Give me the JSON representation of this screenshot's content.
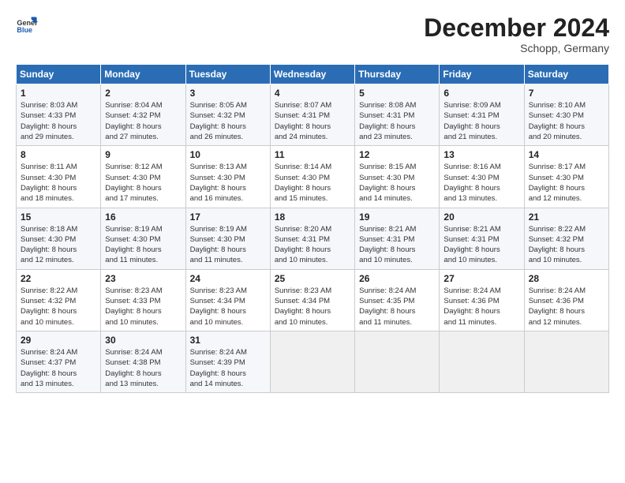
{
  "header": {
    "logo_general": "General",
    "logo_blue": "Blue",
    "month_title": "December 2024",
    "location": "Schopp, Germany"
  },
  "days_of_week": [
    "Sunday",
    "Monday",
    "Tuesday",
    "Wednesday",
    "Thursday",
    "Friday",
    "Saturday"
  ],
  "weeks": [
    [
      {
        "day": "1",
        "info": "Sunrise: 8:03 AM\nSunset: 4:33 PM\nDaylight: 8 hours\nand 29 minutes."
      },
      {
        "day": "2",
        "info": "Sunrise: 8:04 AM\nSunset: 4:32 PM\nDaylight: 8 hours\nand 27 minutes."
      },
      {
        "day": "3",
        "info": "Sunrise: 8:05 AM\nSunset: 4:32 PM\nDaylight: 8 hours\nand 26 minutes."
      },
      {
        "day": "4",
        "info": "Sunrise: 8:07 AM\nSunset: 4:31 PM\nDaylight: 8 hours\nand 24 minutes."
      },
      {
        "day": "5",
        "info": "Sunrise: 8:08 AM\nSunset: 4:31 PM\nDaylight: 8 hours\nand 23 minutes."
      },
      {
        "day": "6",
        "info": "Sunrise: 8:09 AM\nSunset: 4:31 PM\nDaylight: 8 hours\nand 21 minutes."
      },
      {
        "day": "7",
        "info": "Sunrise: 8:10 AM\nSunset: 4:30 PM\nDaylight: 8 hours\nand 20 minutes."
      }
    ],
    [
      {
        "day": "8",
        "info": "Sunrise: 8:11 AM\nSunset: 4:30 PM\nDaylight: 8 hours\nand 18 minutes."
      },
      {
        "day": "9",
        "info": "Sunrise: 8:12 AM\nSunset: 4:30 PM\nDaylight: 8 hours\nand 17 minutes."
      },
      {
        "day": "10",
        "info": "Sunrise: 8:13 AM\nSunset: 4:30 PM\nDaylight: 8 hours\nand 16 minutes."
      },
      {
        "day": "11",
        "info": "Sunrise: 8:14 AM\nSunset: 4:30 PM\nDaylight: 8 hours\nand 15 minutes."
      },
      {
        "day": "12",
        "info": "Sunrise: 8:15 AM\nSunset: 4:30 PM\nDaylight: 8 hours\nand 14 minutes."
      },
      {
        "day": "13",
        "info": "Sunrise: 8:16 AM\nSunset: 4:30 PM\nDaylight: 8 hours\nand 13 minutes."
      },
      {
        "day": "14",
        "info": "Sunrise: 8:17 AM\nSunset: 4:30 PM\nDaylight: 8 hours\nand 12 minutes."
      }
    ],
    [
      {
        "day": "15",
        "info": "Sunrise: 8:18 AM\nSunset: 4:30 PM\nDaylight: 8 hours\nand 12 minutes."
      },
      {
        "day": "16",
        "info": "Sunrise: 8:19 AM\nSunset: 4:30 PM\nDaylight: 8 hours\nand 11 minutes."
      },
      {
        "day": "17",
        "info": "Sunrise: 8:19 AM\nSunset: 4:30 PM\nDaylight: 8 hours\nand 11 minutes."
      },
      {
        "day": "18",
        "info": "Sunrise: 8:20 AM\nSunset: 4:31 PM\nDaylight: 8 hours\nand 10 minutes."
      },
      {
        "day": "19",
        "info": "Sunrise: 8:21 AM\nSunset: 4:31 PM\nDaylight: 8 hours\nand 10 minutes."
      },
      {
        "day": "20",
        "info": "Sunrise: 8:21 AM\nSunset: 4:31 PM\nDaylight: 8 hours\nand 10 minutes."
      },
      {
        "day": "21",
        "info": "Sunrise: 8:22 AM\nSunset: 4:32 PM\nDaylight: 8 hours\nand 10 minutes."
      }
    ],
    [
      {
        "day": "22",
        "info": "Sunrise: 8:22 AM\nSunset: 4:32 PM\nDaylight: 8 hours\nand 10 minutes."
      },
      {
        "day": "23",
        "info": "Sunrise: 8:23 AM\nSunset: 4:33 PM\nDaylight: 8 hours\nand 10 minutes."
      },
      {
        "day": "24",
        "info": "Sunrise: 8:23 AM\nSunset: 4:34 PM\nDaylight: 8 hours\nand 10 minutes."
      },
      {
        "day": "25",
        "info": "Sunrise: 8:23 AM\nSunset: 4:34 PM\nDaylight: 8 hours\nand 10 minutes."
      },
      {
        "day": "26",
        "info": "Sunrise: 8:24 AM\nSunset: 4:35 PM\nDaylight: 8 hours\nand 11 minutes."
      },
      {
        "day": "27",
        "info": "Sunrise: 8:24 AM\nSunset: 4:36 PM\nDaylight: 8 hours\nand 11 minutes."
      },
      {
        "day": "28",
        "info": "Sunrise: 8:24 AM\nSunset: 4:36 PM\nDaylight: 8 hours\nand 12 minutes."
      }
    ],
    [
      {
        "day": "29",
        "info": "Sunrise: 8:24 AM\nSunset: 4:37 PM\nDaylight: 8 hours\nand 13 minutes."
      },
      {
        "day": "30",
        "info": "Sunrise: 8:24 AM\nSunset: 4:38 PM\nDaylight: 8 hours\nand 13 minutes."
      },
      {
        "day": "31",
        "info": "Sunrise: 8:24 AM\nSunset: 4:39 PM\nDaylight: 8 hours\nand 14 minutes."
      },
      {
        "day": "",
        "info": ""
      },
      {
        "day": "",
        "info": ""
      },
      {
        "day": "",
        "info": ""
      },
      {
        "day": "",
        "info": ""
      }
    ]
  ]
}
